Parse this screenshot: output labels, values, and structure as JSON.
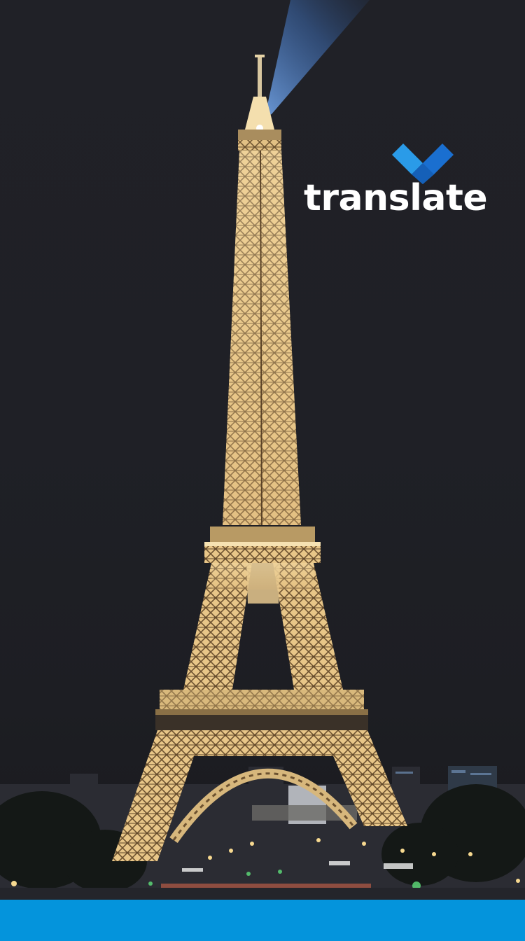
{
  "brand": {
    "name": "translate",
    "logo_icon": "checkmark-chevron-icon",
    "accent_color": "#1a6fd0",
    "accent_color_light": "#2a9be8"
  },
  "background": {
    "subject": "eiffel-tower-night-photo",
    "sky_color": "#1f2026",
    "light_color": "#f2d7a0"
  },
  "footer": {
    "color": "#0494dc"
  }
}
